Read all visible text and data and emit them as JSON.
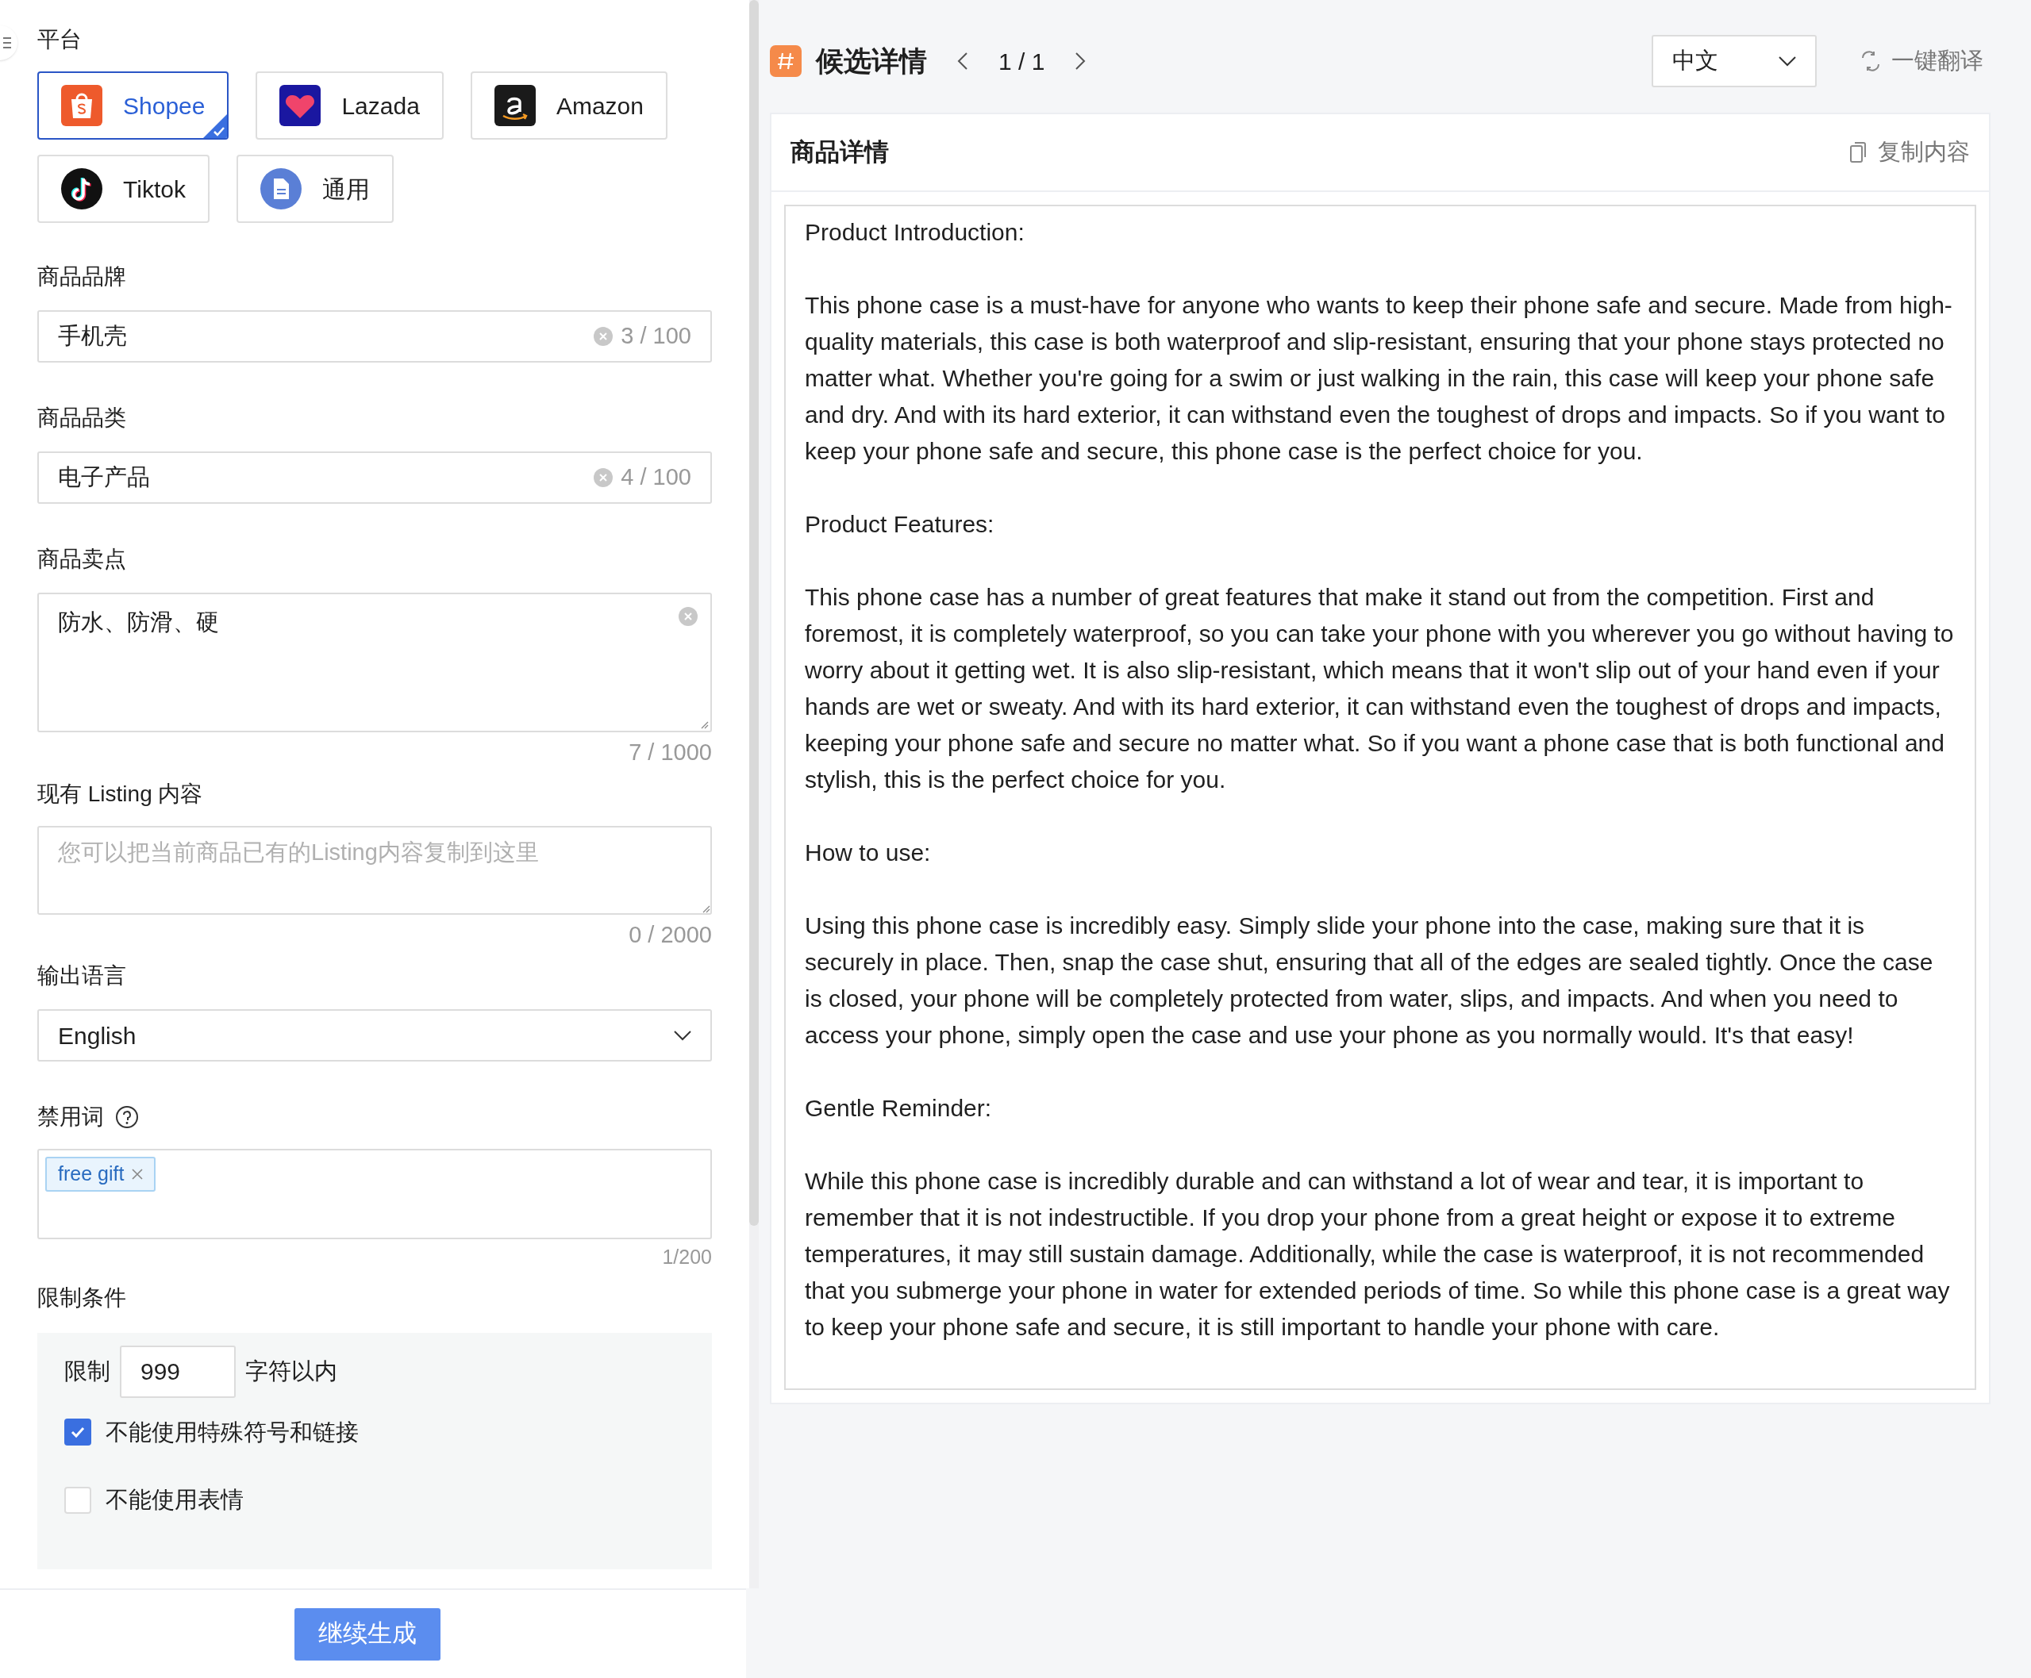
{
  "form": {
    "platform_label": "平台",
    "platforms": [
      {
        "label": "Shopee",
        "selected": true
      },
      {
        "label": "Lazada",
        "selected": false
      },
      {
        "label": "Amazon",
        "selected": false
      },
      {
        "label": "Tiktok",
        "selected": false
      },
      {
        "label": "通用",
        "selected": false
      }
    ],
    "brand": {
      "label": "商品品牌",
      "value": "手机壳",
      "count": "3 / 100"
    },
    "category": {
      "label": "商品品类",
      "value": "电子产品",
      "count": "4 / 100"
    },
    "selling_points": {
      "label": "商品卖点",
      "value": "防水、防滑、硬",
      "count": "7 / 1000"
    },
    "listing": {
      "label": "现有 Listing 内容",
      "placeholder": "您可以把当前商品已有的Listing内容复制到这里",
      "count": "0 / 2000"
    },
    "language": {
      "label": "输出语言",
      "value": "English"
    },
    "banned_words": {
      "label": "禁用词",
      "tags": [
        "free gift"
      ],
      "count": "1/200"
    },
    "limits": {
      "label": "限制条件",
      "limit_prefix": "限制",
      "limit_value": "999",
      "limit_suffix": "字符以内",
      "options": [
        {
          "label": "不能使用特殊符号和链接",
          "checked": true
        },
        {
          "label": "不能使用表情",
          "checked": false
        }
      ]
    },
    "submit": "继续生成"
  },
  "result": {
    "title": "候选详情",
    "pager": "1 / 1",
    "language": "中文",
    "translate": "一键翻译",
    "card_title": "商品详情",
    "copy": "复制内容",
    "paragraphs": [
      "Product Introduction:",
      "This phone case is a must-have for anyone who wants to keep their phone safe and secure. Made from high-quality materials, this case is both waterproof and slip-resistant, ensuring that your phone stays protected no matter what. Whether you're going for a swim or just walking in the rain, this case will keep your phone safe and dry. And with its hard exterior, it can withstand even the toughest of drops and impacts. So if you want to keep your phone safe and secure, this phone case is the perfect choice for you.",
      "Product Features:",
      "This phone case has a number of great features that make it stand out from the competition. First and foremost, it is completely waterproof, so you can take your phone with you wherever you go without having to worry about it getting wet. It is also slip-resistant, which means that it won't slip out of your hand even if your hands are wet or sweaty. And with its hard exterior, it can withstand even the toughest of drops and impacts, keeping your phone safe and secure no matter what. So if you want a phone case that is both functional and stylish, this is the perfect choice for you.",
      "How to use:",
      "Using this phone case is incredibly easy. Simply slide your phone into the case, making sure that it is securely in place. Then, snap the case shut, ensuring that all of the edges are sealed tightly. Once the case is closed, your phone will be completely protected from water, slips, and impacts. And when you need to access your phone, simply open the case and use your phone as you normally would. It's that easy!",
      "Gentle Reminder:",
      "While this phone case is incredibly durable and can withstand a lot of wear and tear, it is important to remember that it is not indestructible. If you drop your phone from a great height or expose it to extreme temperatures, it may still sustain damage. Additionally, while the case is waterproof, it is not recommended that you submerge your phone in water for extended periods of time. So while this phone case is a great way to keep your phone safe and secure, it is still important to handle your phone with care."
    ]
  }
}
